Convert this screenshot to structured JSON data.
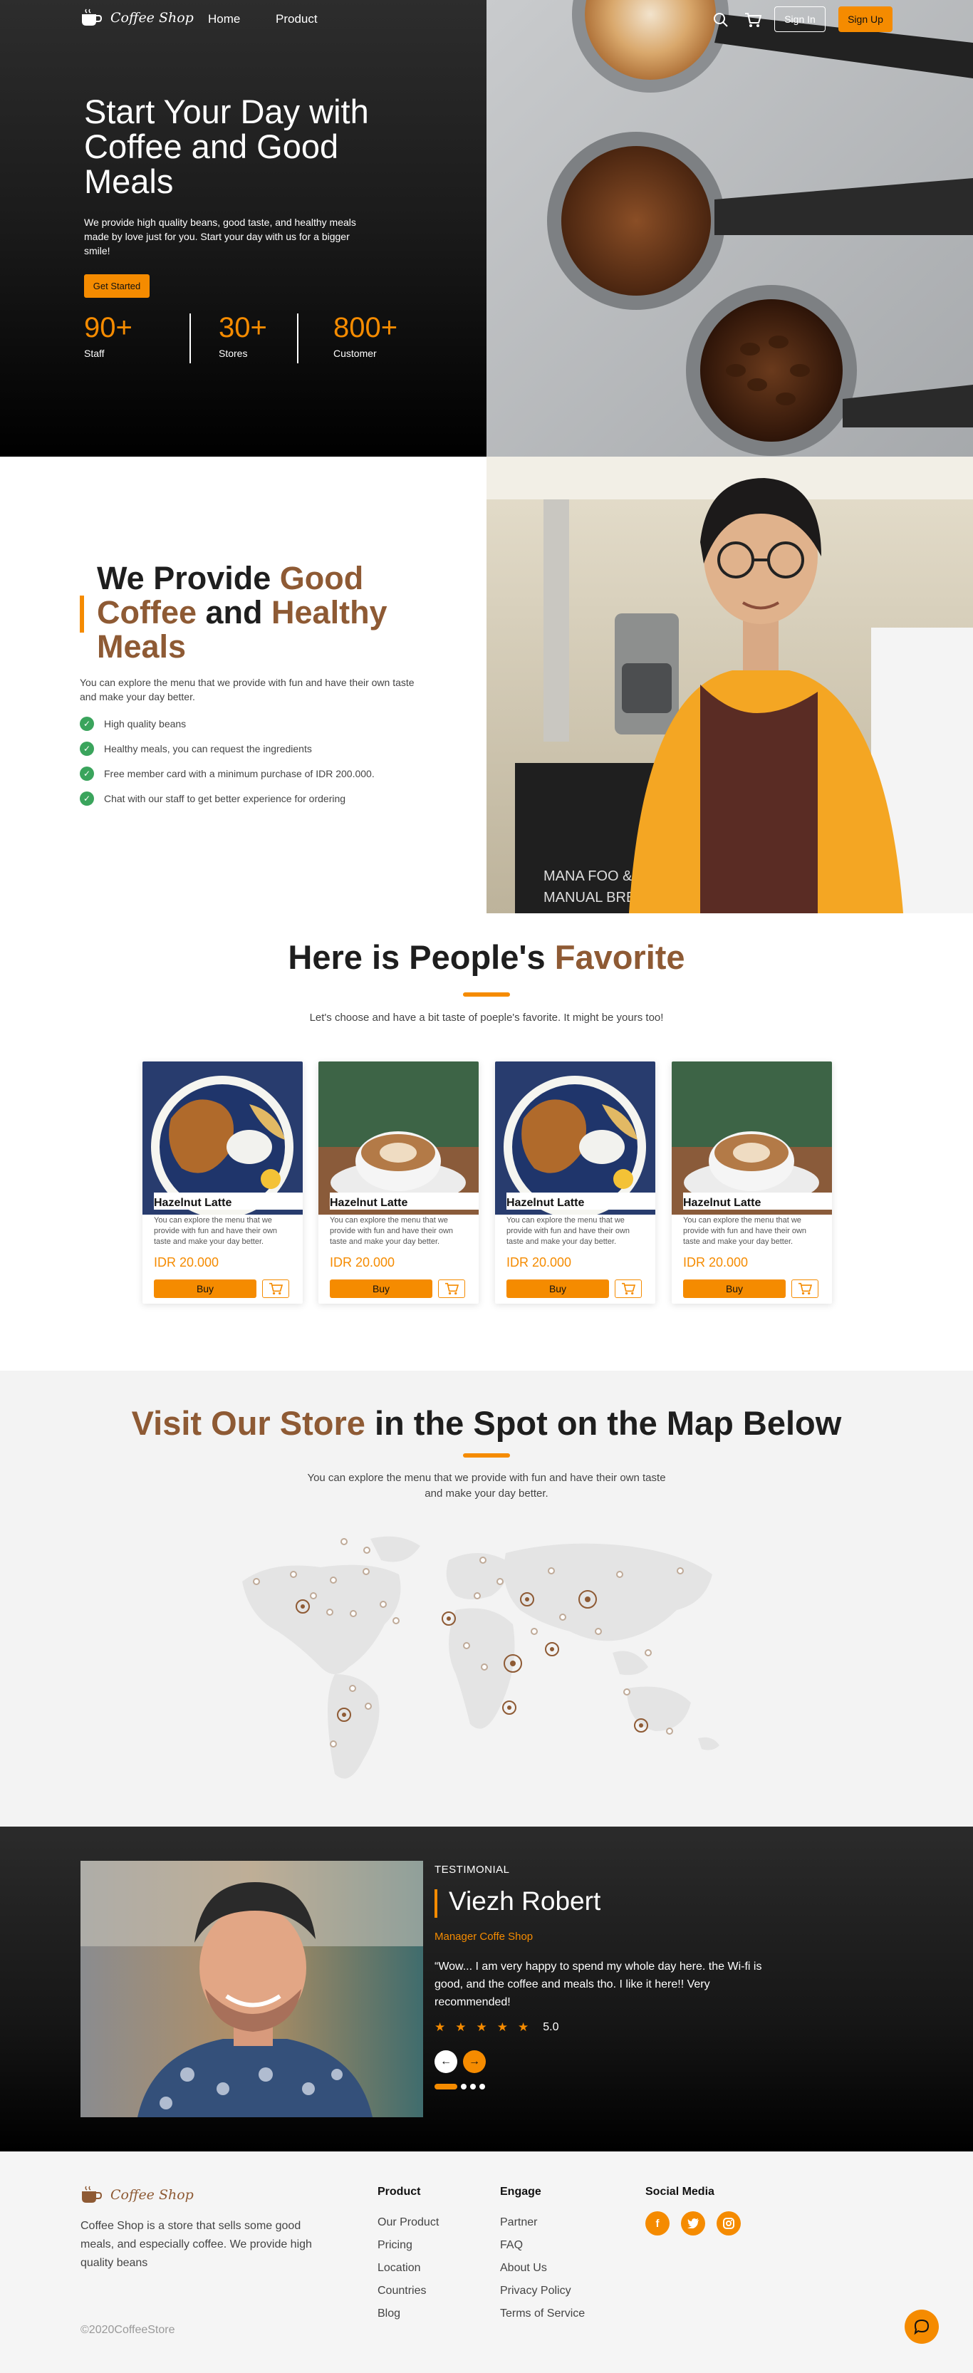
{
  "nav": {
    "logo_text": "Coffee Shop",
    "links": [
      "Home",
      "Product"
    ],
    "sign_in": "Sign In",
    "sign_up": "Sign Up"
  },
  "hero": {
    "title": "Start Your Day with Coffee and Good Meals",
    "description": "We provide high quality beans, good taste, and healthy meals made by love just for you. Start your day with us for a bigger smile!",
    "cta": "Get Started",
    "stats": [
      {
        "value": "90+",
        "label": "Staff"
      },
      {
        "value": "30+",
        "label": "Stores"
      },
      {
        "value": "800+",
        "label": "Customer"
      }
    ]
  },
  "provide": {
    "title_part1": "We Provide ",
    "title_part2": "Good Coffee",
    "title_part3": " and ",
    "title_part4": "Healthy Meals",
    "description": "You can explore the menu that we provide with fun and have their own taste and make your day better.",
    "features": [
      "High quality beans",
      "Healthy meals, you can request the ingredients",
      "Free member card with a minimum purchase of IDR 200.000.",
      "Chat with our staff to get better experience for ordering"
    ]
  },
  "favorite": {
    "title_part1": "Here is People's ",
    "title_part2": "Favorite",
    "subtitle": "Let's choose and have a bit taste of poeple's favorite. It might be yours too!",
    "products": [
      {
        "name": "Hazelnut Latte",
        "description": "You can explore the menu that we provide with fun and have their own taste and make your day better.",
        "price": "IDR 20.000",
        "buy": "Buy",
        "image": "food"
      },
      {
        "name": "Hazelnut Latte",
        "description": "You can explore the menu that we provide with fun and have their own taste and make your day better.",
        "price": "IDR 20.000",
        "buy": "Buy",
        "image": "coffee"
      },
      {
        "name": "Hazelnut Latte",
        "description": "You can explore the menu that we provide with fun and have their own taste and make your day better.",
        "price": "IDR 20.000",
        "buy": "Buy",
        "image": "food"
      },
      {
        "name": "Hazelnut Latte",
        "description": "You can explore the menu that we provide with fun and have their own taste and make your day better.",
        "price": "IDR 20.000",
        "buy": "Buy",
        "image": "coffee"
      }
    ]
  },
  "store": {
    "title_part1": "Visit Our Store",
    "title_part2": " in the Spot on the Map Below",
    "subtitle": "You can explore the menu that we provide with fun and have their own taste and make your day better."
  },
  "testimonial": {
    "label": "TESTIMONIAL",
    "name": "Viezh Robert",
    "role": "Manager Coffe Shop",
    "quote": "“Wow... I am very happy to spend my whole day here. the Wi-fi is good, and the coffee and meals tho. I like it here!! Very recommended!",
    "rating": "5.0",
    "stars": 5
  },
  "footer": {
    "logo_text": "Coffee Shop",
    "description": "Coffee Shop is a store that sells some good meals, and especially coffee. We provide high quality beans",
    "copyright": "©2020CoffeeStore",
    "columns": [
      {
        "title": "Product",
        "links": [
          "Our Product",
          "Pricing",
          "Location",
          "Countries",
          "Blog"
        ]
      },
      {
        "title": "Engage",
        "links": [
          "Partner",
          "FAQ",
          "About Us",
          "Privacy Policy",
          "Terms of Service"
        ]
      }
    ],
    "social_title": "Social Media",
    "social": [
      "f",
      "t",
      "ig"
    ]
  },
  "colors": {
    "accent": "#f58b00",
    "brown": "#8e5a34",
    "dark": "#1a1a1a"
  }
}
